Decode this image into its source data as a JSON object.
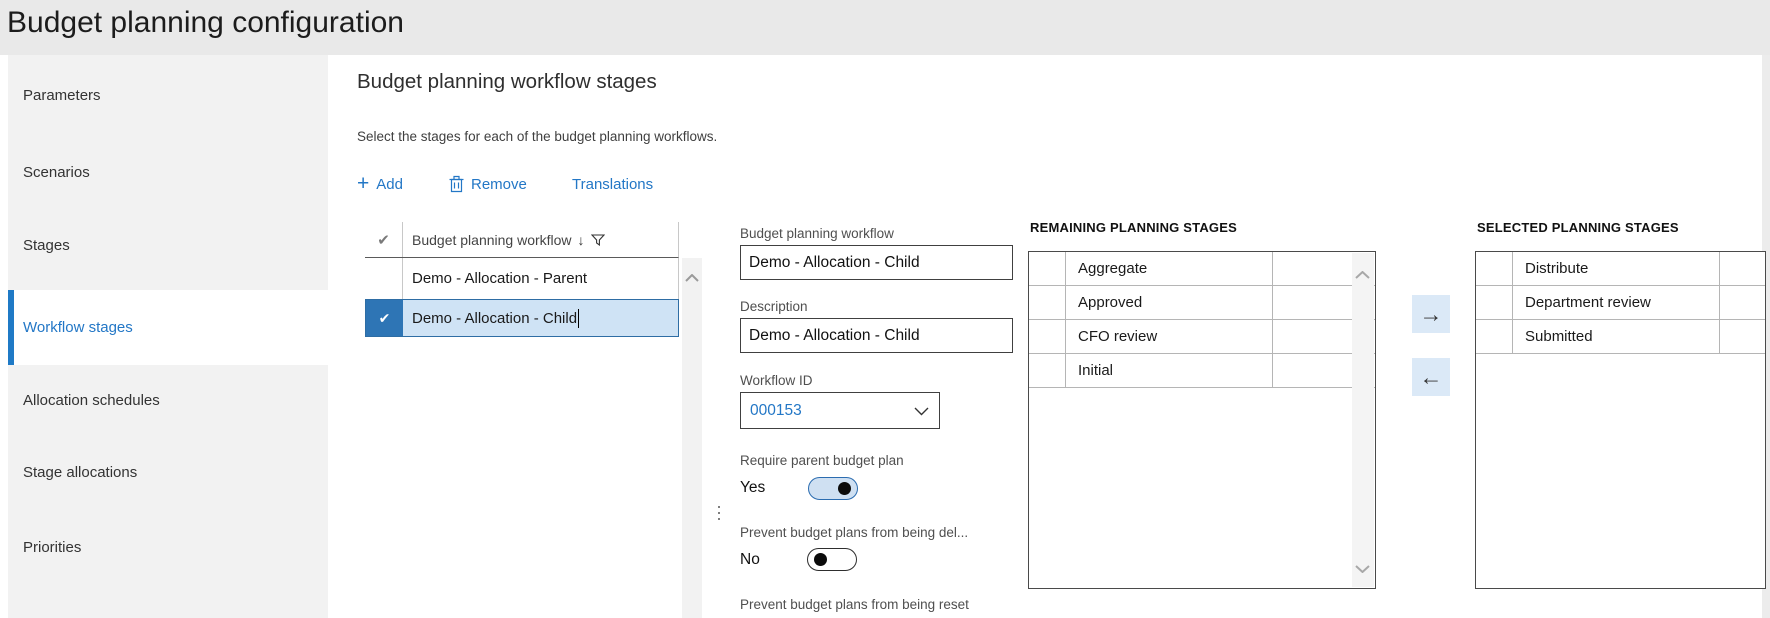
{
  "page": {
    "title": "Budget planning configuration"
  },
  "colors": {
    "accent_blue": "#2377c6",
    "titlebar_gray": "#e9e9e9",
    "sidebar_gray": "#f2f2f2",
    "selected_row_bg": "#cfe3f5",
    "selected_row_border": "#2e6da4",
    "selected_check_bg": "#2e75b5",
    "move_button_bg": "#dbe9f7",
    "toggle_on_fill": "#cfe0f2",
    "toggle_on_border": "#2b6cb0"
  },
  "sidebar": {
    "items": [
      {
        "label": "Parameters",
        "selected": false
      },
      {
        "label": "Scenarios",
        "selected": false
      },
      {
        "label": "Stages",
        "selected": false
      },
      {
        "label": "Workflow stages",
        "selected": true
      },
      {
        "label": "Allocation schedules",
        "selected": false
      },
      {
        "label": "Stage allocations",
        "selected": false
      },
      {
        "label": "Priorities",
        "selected": false
      }
    ]
  },
  "main": {
    "heading": "Budget planning workflow stages",
    "subtitle": "Select the stages for each of the budget planning workflows.",
    "toolbar": {
      "add": "Add",
      "remove": "Remove",
      "translations": "Translations"
    },
    "grid": {
      "header": "Budget planning workflow",
      "rows": [
        {
          "name": "Demo - Allocation - Parent",
          "selected": false
        },
        {
          "name": "Demo - Allocation - Child",
          "selected": true
        }
      ]
    },
    "form": {
      "workflow": {
        "label": "Budget planning workflow",
        "value": "Demo - Allocation - Child"
      },
      "description": {
        "label": "Description",
        "value": "Demo - Allocation - Child"
      },
      "workflow_id": {
        "label": "Workflow ID",
        "value": "000153"
      },
      "require_parent": {
        "label": "Require parent budget plan",
        "value": "Yes",
        "state": "on"
      },
      "prevent_delete": {
        "label": "Prevent budget plans from being del...",
        "value": "No",
        "state": "off"
      },
      "prevent_reset": {
        "label": "Prevent budget plans from being reset"
      }
    },
    "remaining": {
      "heading": "REMAINING PLANNING STAGES",
      "rows": [
        "Aggregate",
        "Approved",
        "CFO review",
        "Initial"
      ]
    },
    "selected": {
      "heading": "SELECTED PLANNING STAGES",
      "rows": [
        "Distribute",
        "Department review",
        "Submitted"
      ]
    }
  },
  "icons": {
    "add": "+",
    "sort_descending": "↓",
    "check": "✔",
    "move_right": "→",
    "move_left": "←"
  }
}
